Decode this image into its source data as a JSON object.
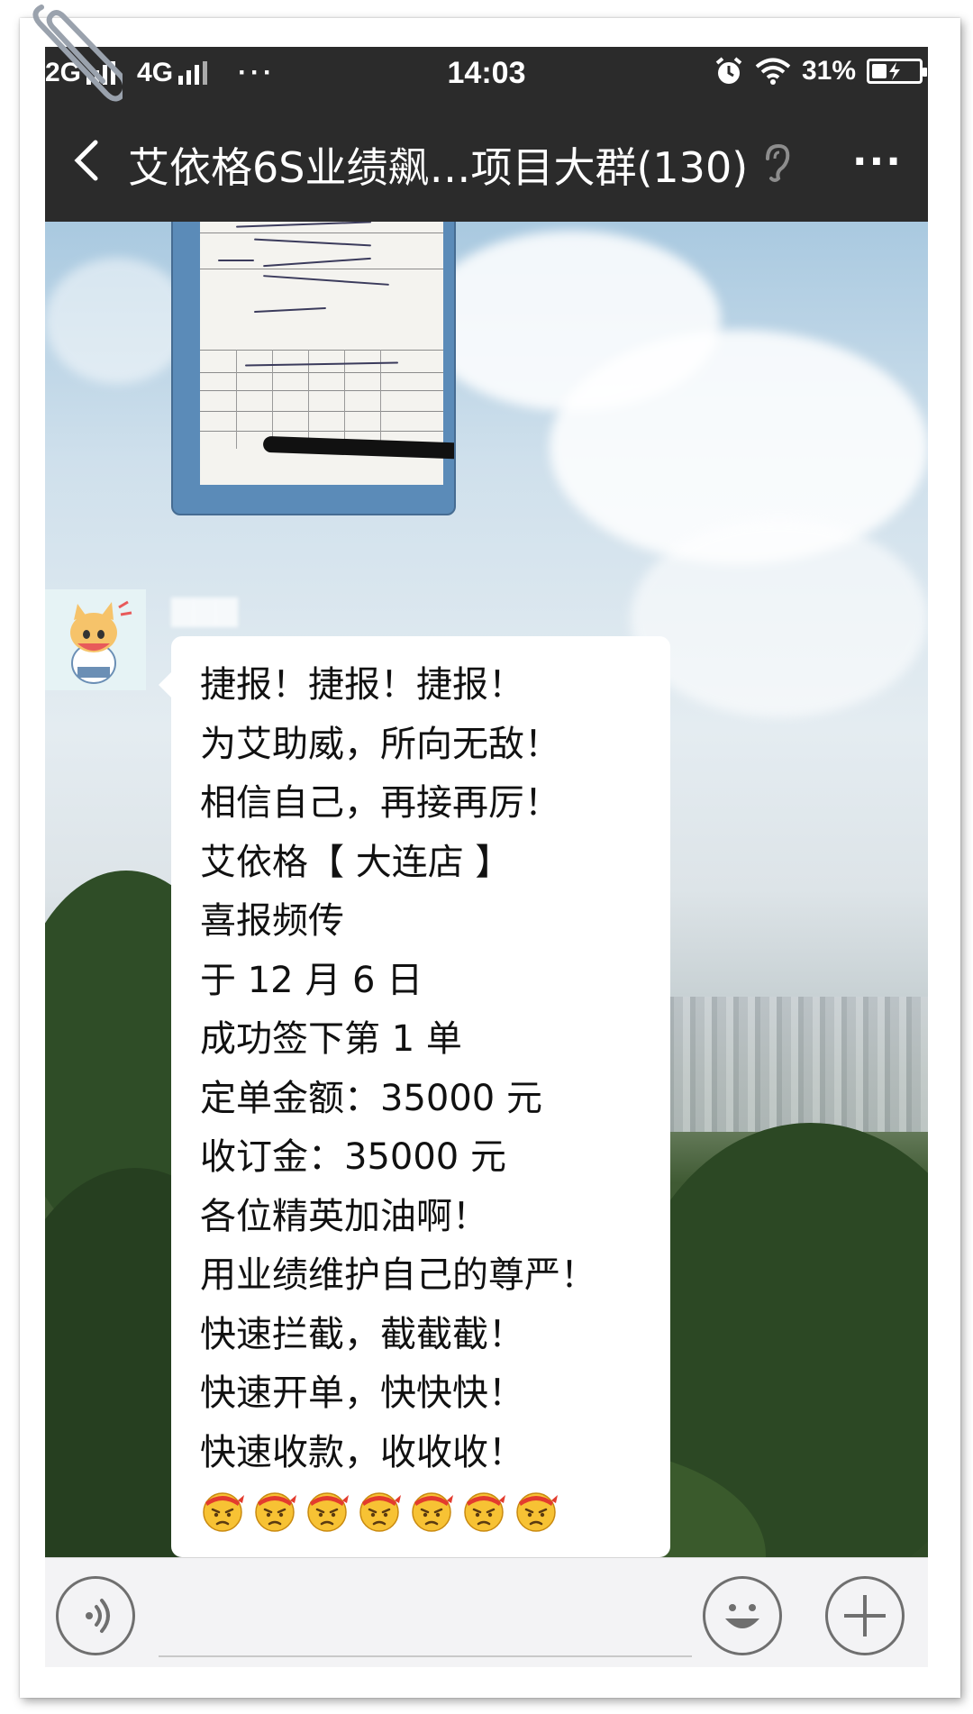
{
  "status_bar": {
    "signal_1": "2G",
    "signal_2": "4G",
    "more": "···",
    "time": "14:03",
    "battery": "31%"
  },
  "title_bar": {
    "title": "艾依格6S业绩飙…项目大群(130)"
  },
  "chat": {
    "message_lines": [
      "捷报！捷报！捷报！",
      "为艾助威，所向无敌！",
      "相信自己，再接再厉！",
      "艾依格【 大连店 】",
      "喜报频传",
      "于 12 月 6 日",
      "成功签下第 1 单",
      "定单金额：35000 元",
      "收订金：35000 元",
      "各位精英加油啊！",
      "用业绩维护自己的尊严！",
      "快速拦截，截截截！",
      "快速开单，快快快！",
      "快速收款，收收收！"
    ],
    "emoji_count": 7,
    "emoji_name": "determined-headband-emoji"
  },
  "colors": {
    "header_bg": "#2b2b2b",
    "bubble_bg": "#ffffff",
    "input_bg": "#f3f3f5"
  }
}
